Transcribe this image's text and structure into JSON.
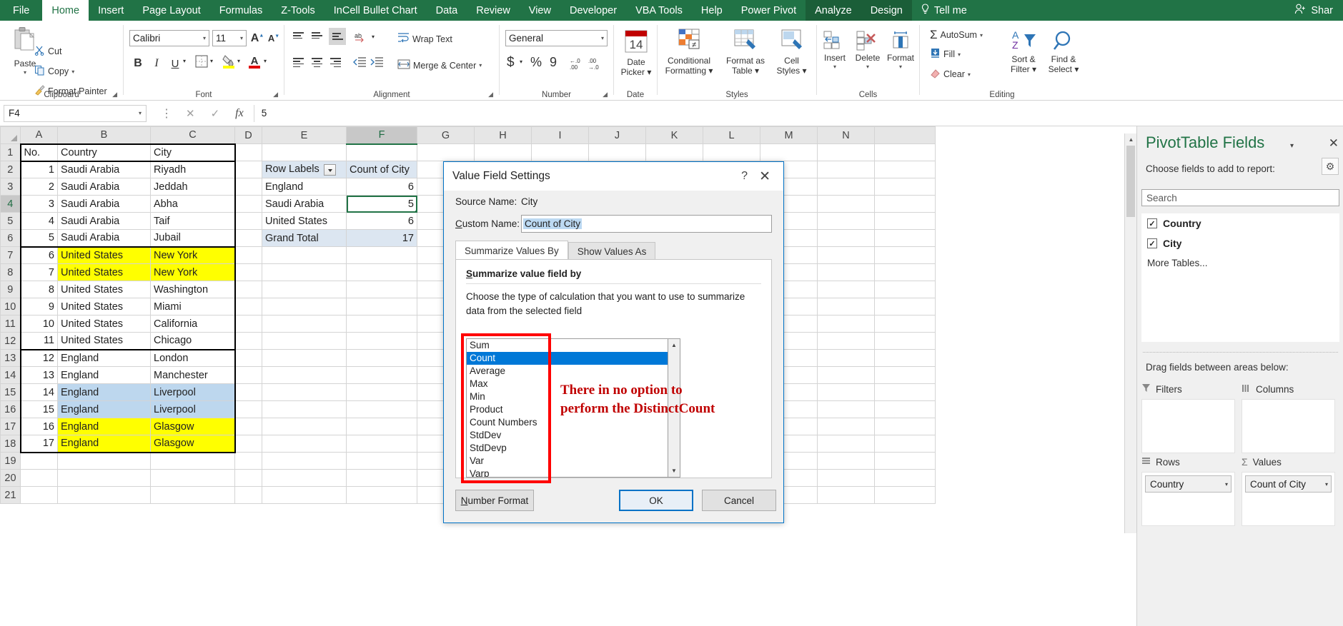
{
  "ribbon": {
    "tabs": [
      {
        "label": "File",
        "state": "file"
      },
      {
        "label": "Home",
        "state": "active"
      },
      {
        "label": "Insert",
        "state": "normal"
      },
      {
        "label": "Page Layout",
        "state": "normal"
      },
      {
        "label": "Formulas",
        "state": "normal"
      },
      {
        "label": "Z-Tools",
        "state": "normal"
      },
      {
        "label": "InCell Bullet Chart",
        "state": "normal"
      },
      {
        "label": "Data",
        "state": "normal"
      },
      {
        "label": "Review",
        "state": "normal"
      },
      {
        "label": "View",
        "state": "normal"
      },
      {
        "label": "Developer",
        "state": "normal"
      },
      {
        "label": "VBA Tools",
        "state": "normal"
      },
      {
        "label": "Help",
        "state": "normal"
      },
      {
        "label": "Power Pivot",
        "state": "normal"
      },
      {
        "label": "Analyze",
        "state": "ctx"
      },
      {
        "label": "Design",
        "state": "ctx"
      }
    ],
    "tell_me": "Tell me",
    "share": "Shar",
    "groups": {
      "clipboard": "Clipboard",
      "font": "Font",
      "alignment": "Alignment",
      "number": "Number",
      "date": "Date",
      "styles": "Styles",
      "cells": "Cells",
      "editing": "Editing"
    },
    "clipboard": {
      "paste": "Paste",
      "cut": "Cut",
      "copy": "Copy",
      "format_painter": "Format Painter"
    },
    "font": {
      "family": "Calibri",
      "size": "11",
      "grow": "A",
      "shrink": "A",
      "bold": "B",
      "italic": "I",
      "underline": "U"
    },
    "alignment": {
      "wrap_text": "Wrap Text",
      "merge_center": "Merge & Center"
    },
    "number": {
      "format": "General",
      "currency": "$",
      "percent": "%",
      "comma": "9"
    },
    "date": {
      "picker_line1": "Date",
      "picker_line2": "Picker"
    },
    "styles": {
      "cond_line1": "Conditional",
      "cond_line2": "Formatting",
      "fmt_line1": "Format as",
      "fmt_line2": "Table",
      "cell_line1": "Cell",
      "cell_line2": "Styles"
    },
    "cells": {
      "insert": "Insert",
      "delete": "Delete",
      "format": "Format"
    },
    "editing": {
      "autosum": "AutoSum",
      "fill": "Fill",
      "clear": "Clear",
      "sort_line1": "Sort &",
      "sort_line2": "Filter",
      "find_line1": "Find &",
      "find_line2": "Select"
    }
  },
  "formula_bar": {
    "name_box": "F4",
    "formula": "5",
    "cancel_icon": "✕",
    "enter_icon": "✓",
    "fx": "fx"
  },
  "sheet": {
    "column_headers": [
      "A",
      "B",
      "C",
      "D",
      "E",
      "F",
      "G",
      "H",
      "I",
      "J",
      "K",
      "L",
      "M",
      "N"
    ],
    "selected_column": "F",
    "row_headers": [
      "1",
      "2",
      "3",
      "4",
      "5",
      "6",
      "7",
      "8",
      "9",
      "10",
      "11",
      "12",
      "13",
      "14",
      "15",
      "16",
      "17",
      "18",
      "19",
      "20",
      "21"
    ],
    "selected_row": "4",
    "headers": {
      "no": "No.",
      "country": "Country",
      "city": "City"
    },
    "rows": [
      {
        "no": "1",
        "country": "Saudi Arabia",
        "city": "Riyadh",
        "fill": "none"
      },
      {
        "no": "2",
        "country": "Saudi Arabia",
        "city": "Jeddah",
        "fill": "none"
      },
      {
        "no": "3",
        "country": "Saudi Arabia",
        "city": "Abha",
        "fill": "none"
      },
      {
        "no": "4",
        "country": "Saudi Arabia",
        "city": "Taif",
        "fill": "none"
      },
      {
        "no": "5",
        "country": "Saudi Arabia",
        "city": "Jubail",
        "fill": "none"
      },
      {
        "no": "6",
        "country": "United States",
        "city": "New York",
        "fill": "yellow"
      },
      {
        "no": "7",
        "country": "United States",
        "city": "New York",
        "fill": "yellow"
      },
      {
        "no": "8",
        "country": "United States",
        "city": "Washington",
        "fill": "none"
      },
      {
        "no": "9",
        "country": "United States",
        "city": "Miami",
        "fill": "none"
      },
      {
        "no": "10",
        "country": "United States",
        "city": "California",
        "fill": "none"
      },
      {
        "no": "11",
        "country": "United States",
        "city": "Chicago",
        "fill": "none"
      },
      {
        "no": "12",
        "country": "England",
        "city": "London",
        "fill": "none"
      },
      {
        "no": "13",
        "country": "England",
        "city": "Manchester",
        "fill": "none"
      },
      {
        "no": "14",
        "country": "England",
        "city": "Liverpool",
        "fill": "blue"
      },
      {
        "no": "15",
        "country": "England",
        "city": "Liverpool",
        "fill": "blue"
      },
      {
        "no": "16",
        "country": "England",
        "city": "Glasgow",
        "fill": "yellow"
      },
      {
        "no": "17",
        "country": "England",
        "city": "Glasgow",
        "fill": "yellow"
      }
    ]
  },
  "pivot": {
    "row_labels_header": "Row Labels",
    "value_header": "Count of City",
    "rows": [
      {
        "label": "England",
        "value": "6"
      },
      {
        "label": "Saudi Arabia",
        "value": "5"
      },
      {
        "label": "United States",
        "value": "6"
      }
    ],
    "grand_total_label": "Grand Total",
    "grand_total_value": "17"
  },
  "dialog": {
    "title": "Value Field Settings",
    "help_icon": "?",
    "close_icon": "✕",
    "source_name_label": "Source Name:",
    "source_name_value": "City",
    "custom_name_label": "Custom Name:",
    "custom_name_value": "Count of City",
    "tabs": [
      {
        "label": "Summarize Values By",
        "active": true
      },
      {
        "label": "Show Values As",
        "active": false
      }
    ],
    "panel_heading": "Summarize value field by",
    "panel_text_line1": "Choose the type of calculation that you want to use to summarize",
    "panel_text_line2": "data from the selected field",
    "functions": [
      "Sum",
      "Count",
      "Average",
      "Max",
      "Min",
      "Product",
      "Count Numbers",
      "StdDev",
      "StdDevp",
      "Var",
      "Varp"
    ],
    "selected_function": "Count",
    "annotation_line1": "There in no option to",
    "annotation_line2": "perform the DistinctCount",
    "annotation_color": "#c00000",
    "highlight_color": "#ff0000",
    "number_format_button": "Number Format",
    "ok_button": "OK",
    "cancel_button": "Cancel"
  },
  "pivot_pane": {
    "title": "PivotTable Fields",
    "caret_icon": "▾",
    "close_icon": "✕",
    "subtitle": "Choose fields to add to report:",
    "gear_icon": "⚙",
    "search_placeholder": "Search",
    "fields": [
      {
        "label": "Country",
        "checked": true
      },
      {
        "label": "City",
        "checked": true
      }
    ],
    "more_tables": "More Tables...",
    "drag_hint": "Drag fields between areas below:",
    "areas": [
      {
        "name": "Filters",
        "icon": "filter-icon",
        "items": []
      },
      {
        "name": "Columns",
        "icon": "columns-icon",
        "items": []
      },
      {
        "name": "Rows",
        "icon": "rows-icon",
        "items": [
          "Country"
        ]
      },
      {
        "name": "Values",
        "icon": "sigma-icon",
        "items": [
          "Count of City"
        ]
      }
    ]
  }
}
